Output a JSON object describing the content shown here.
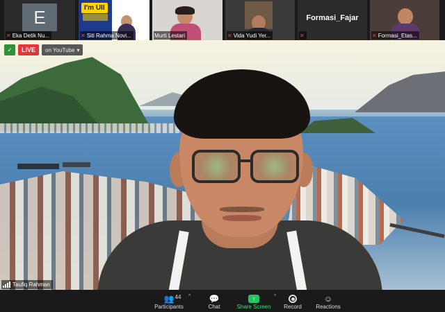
{
  "participants_strip": [
    {
      "name": "Eka Detik Nu...",
      "avatar_letter": "E",
      "muted": true
    },
    {
      "name": "Siti Rahma Novi...",
      "logo_text": "I'm UII",
      "muted": true
    },
    {
      "name": "Murti Lestari",
      "muted": false
    },
    {
      "name": "Vida Yudi Yer...",
      "muted": true
    },
    {
      "name": "Formasi_Fajar",
      "big_label": "Formasi_Fajar",
      "muted": true
    },
    {
      "name": "Formasi_Etas...",
      "muted": true
    }
  ],
  "live": {
    "badge": "LIVE",
    "where": "on YouTube",
    "shield_color": "#2f8f3a",
    "badge_color": "#e5353b"
  },
  "active_speaker": {
    "name": "Taufiq Rahman"
  },
  "toolbar": {
    "participants_label": "Participants",
    "participants_count": "44",
    "chat_label": "Chat",
    "share_label": "Share Screen",
    "record_label": "Record",
    "reactions_label": "Reactions",
    "share_color": "#23c55e"
  }
}
